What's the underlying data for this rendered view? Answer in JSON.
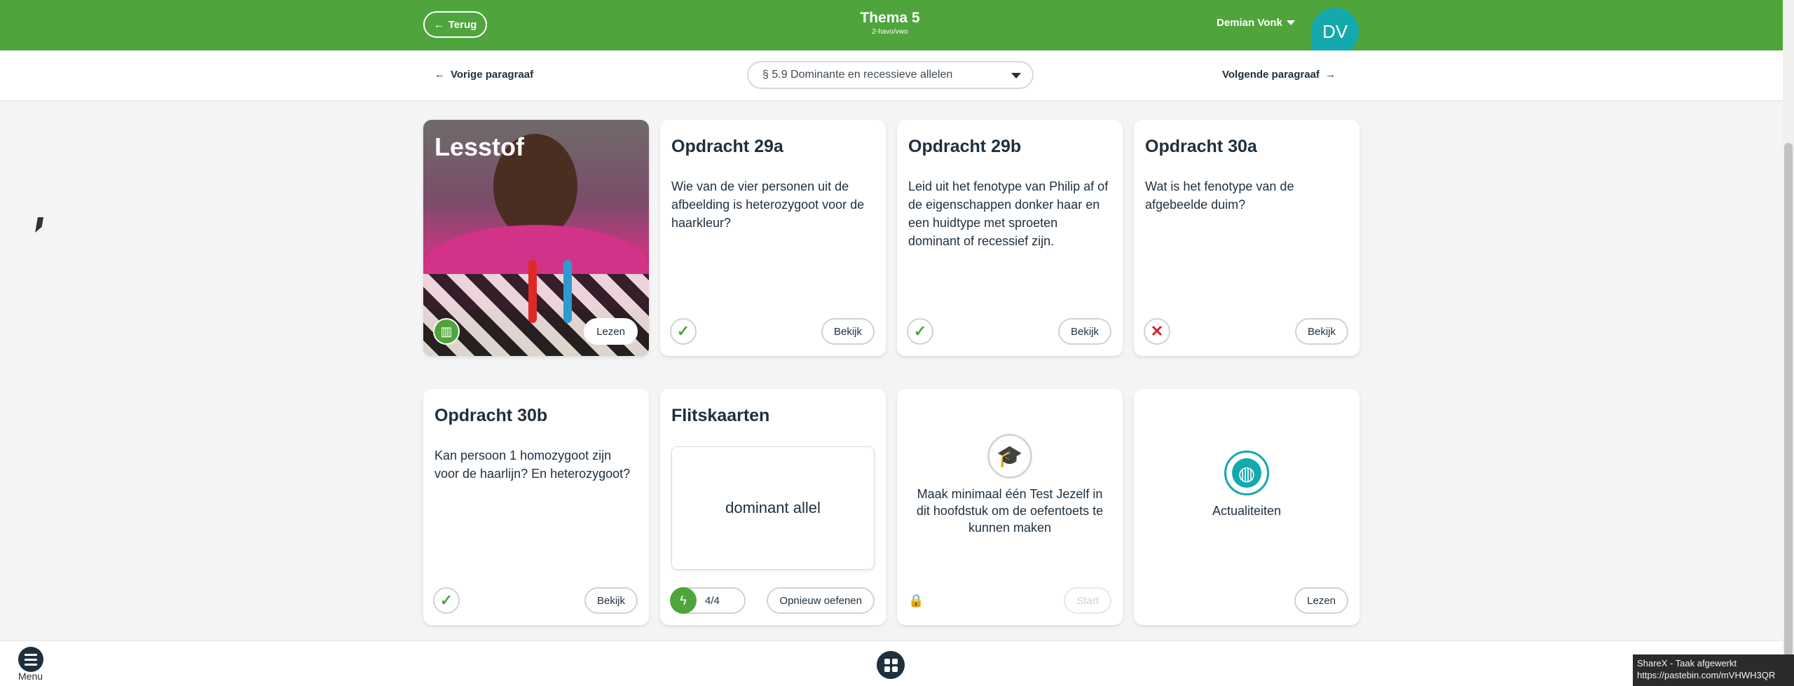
{
  "topbar": {
    "back_label": "Terug",
    "title": "Thema 5",
    "subtitle": "2-havo/vwo",
    "user_name": "Demian Vonk",
    "avatar_initials": "DV",
    "bg_color": "#4fa53c",
    "avatar_color": "#13a9ad"
  },
  "subnav": {
    "prev_label": "Vorige paragraaf",
    "next_label": "Volgende paragraaf",
    "selected_paragraph": "§ 5.9 Dominante en recessieve allelen"
  },
  "cards": {
    "lesstof": {
      "title": "Lesstof",
      "button": "Lezen",
      "icon": "book-icon"
    },
    "c29a": {
      "title": "Opdracht 29a",
      "text": "Wie van de vier personen uit de afbeelding is heterozygoot voor de haarkleur?",
      "button": "Bekijk",
      "status": "correct",
      "status_glyph": "✓"
    },
    "c29b": {
      "title": "Opdracht 29b",
      "text": "Leid uit het fenotype van Philip af of de eigenschappen donker haar en een huidtype met sproeten dominant of recessief zijn.",
      "button": "Bekijk",
      "status": "correct",
      "status_glyph": "✓"
    },
    "c30a": {
      "title": "Opdracht 30a",
      "text": "Wat is het fenotype van de afgebeelde duim?",
      "button": "Bekijk",
      "status": "incorrect",
      "status_glyph": "✕"
    },
    "c30b": {
      "title": "Opdracht 30b",
      "text": "Kan persoon 1 homozygoot zijn voor de haarlijn? En heterozygoot?",
      "button": "Bekijk",
      "status": "correct",
      "status_glyph": "✓"
    },
    "flash": {
      "title": "Flitskaarten",
      "card_text": "dominant allel",
      "count": "4/4",
      "button": "Opnieuw oefenen"
    },
    "test": {
      "text": "Maak minimaal één Test Jezelf in dit hoofdstuk om de oefentoets te kunnen maken",
      "button": "Start",
      "locked": true
    },
    "news": {
      "label": "Actualiteiten",
      "button": "Lezen"
    }
  },
  "bottombar": {
    "menu_label": "Menu"
  },
  "toast": {
    "line1": "ShareX - Taak afgewerkt",
    "line2": "https://pastebin.com/mVHWH3QR"
  }
}
